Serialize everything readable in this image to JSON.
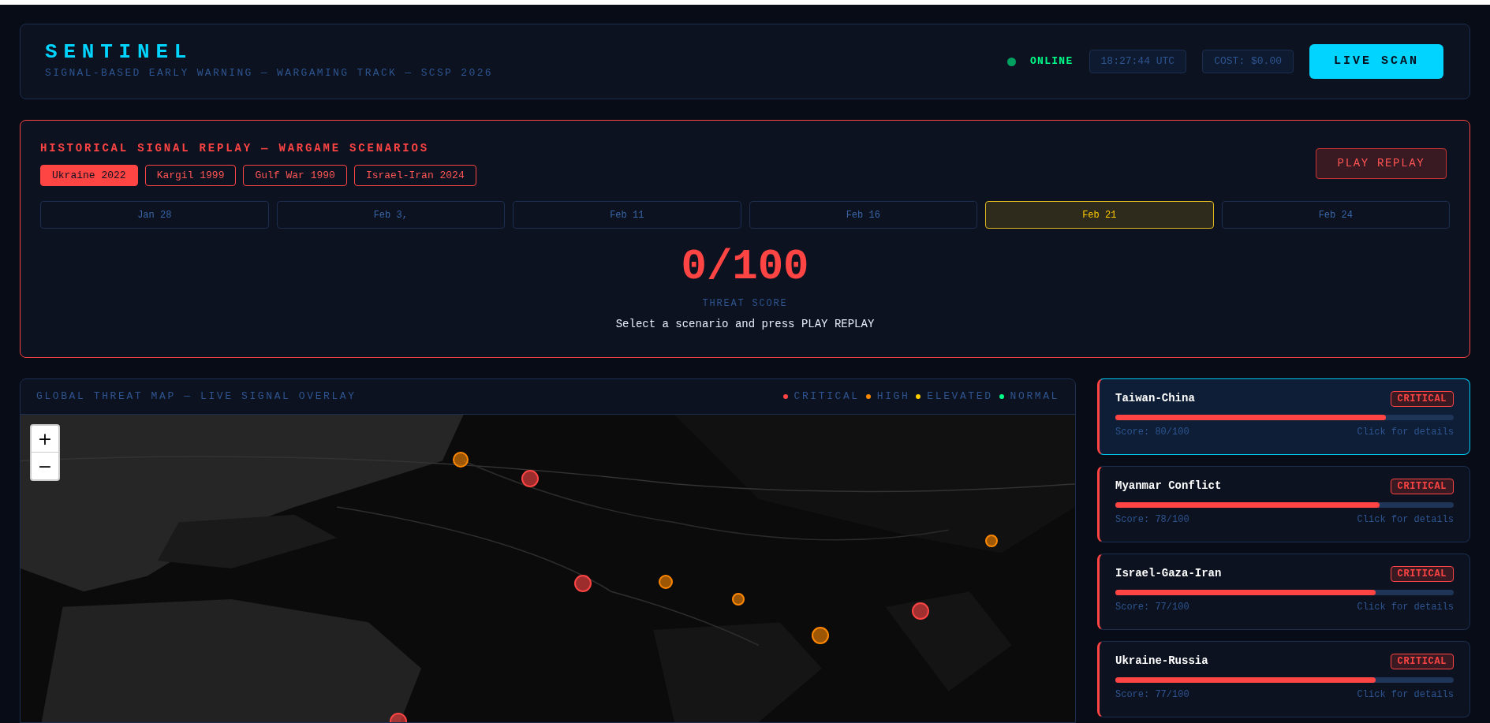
{
  "header": {
    "title": "SENTINEL",
    "subtitle": "SIGNAL-BASED EARLY WARNING — WARGAMING TRACK — SCSP 2026",
    "status": {
      "label": "ONLINE",
      "online": true
    },
    "clock": "18:27:44 UTC",
    "cost": "COST: $0.00",
    "scan_button": "LIVE SCAN"
  },
  "replay": {
    "title": "HISTORICAL SIGNAL REPLAY — WARGAME SCENARIOS",
    "scenarios": [
      {
        "label": "Ukraine 2022",
        "selected": true
      },
      {
        "label": "Kargil 1999",
        "selected": false
      },
      {
        "label": "Gulf War 1990",
        "selected": false
      },
      {
        "label": "Israel-Iran 2024",
        "selected": false
      }
    ],
    "play_button": "PLAY REPLAY",
    "dates": [
      {
        "label": "Jan 28",
        "selected": false
      },
      {
        "label": "Feb 3,",
        "selected": false
      },
      {
        "label": "Feb 11",
        "selected": false
      },
      {
        "label": "Feb 16",
        "selected": false
      },
      {
        "label": "Feb 21",
        "selected": true
      },
      {
        "label": "Feb 24",
        "selected": false
      }
    ],
    "score": "0/100",
    "score_label": "THREAT SCORE",
    "hint": "Select a scenario and press PLAY REPLAY"
  },
  "map": {
    "title": "GLOBAL THREAT MAP — LIVE SIGNAL OVERLAY",
    "legend": [
      {
        "label": "CRITICAL",
        "color": "#ff4444"
      },
      {
        "label": "HIGH",
        "color": "#ff8800"
      },
      {
        "label": "ELEVATED",
        "color": "#ffcc00"
      },
      {
        "label": "NORMAL",
        "color": "#00ff88"
      }
    ],
    "zoom_in": "+",
    "zoom_out": "−",
    "markers": [
      {
        "color": "#ff8800"
      },
      {
        "color": "#ff4444"
      },
      {
        "color": "#ff4444"
      },
      {
        "color": "#ff8800"
      },
      {
        "color": "#ff8800"
      },
      {
        "color": "#ff4444"
      },
      {
        "color": "#ff4444"
      },
      {
        "color": "#ff8800"
      },
      {
        "color": "#ff8800"
      }
    ]
  },
  "threats": [
    {
      "name": "Taiwan-China",
      "badge": "CRITICAL",
      "level": 0.8,
      "score": "Score: 80/100",
      "link": "Click for details",
      "selected": true
    },
    {
      "name": "Myanmar Conflict",
      "badge": "CRITICAL",
      "level": 0.78,
      "score": "Score: 78/100",
      "link": "Click for details",
      "selected": false
    },
    {
      "name": "Israel-Gaza-Iran",
      "badge": "CRITICAL",
      "level": 0.77,
      "score": "Score: 77/100",
      "link": "Click for details",
      "selected": false
    },
    {
      "name": "Ukraine-Russia",
      "badge": "CRITICAL",
      "level": 0.77,
      "score": "Score: 77/100",
      "link": "Click for details",
      "selected": false
    }
  ]
}
